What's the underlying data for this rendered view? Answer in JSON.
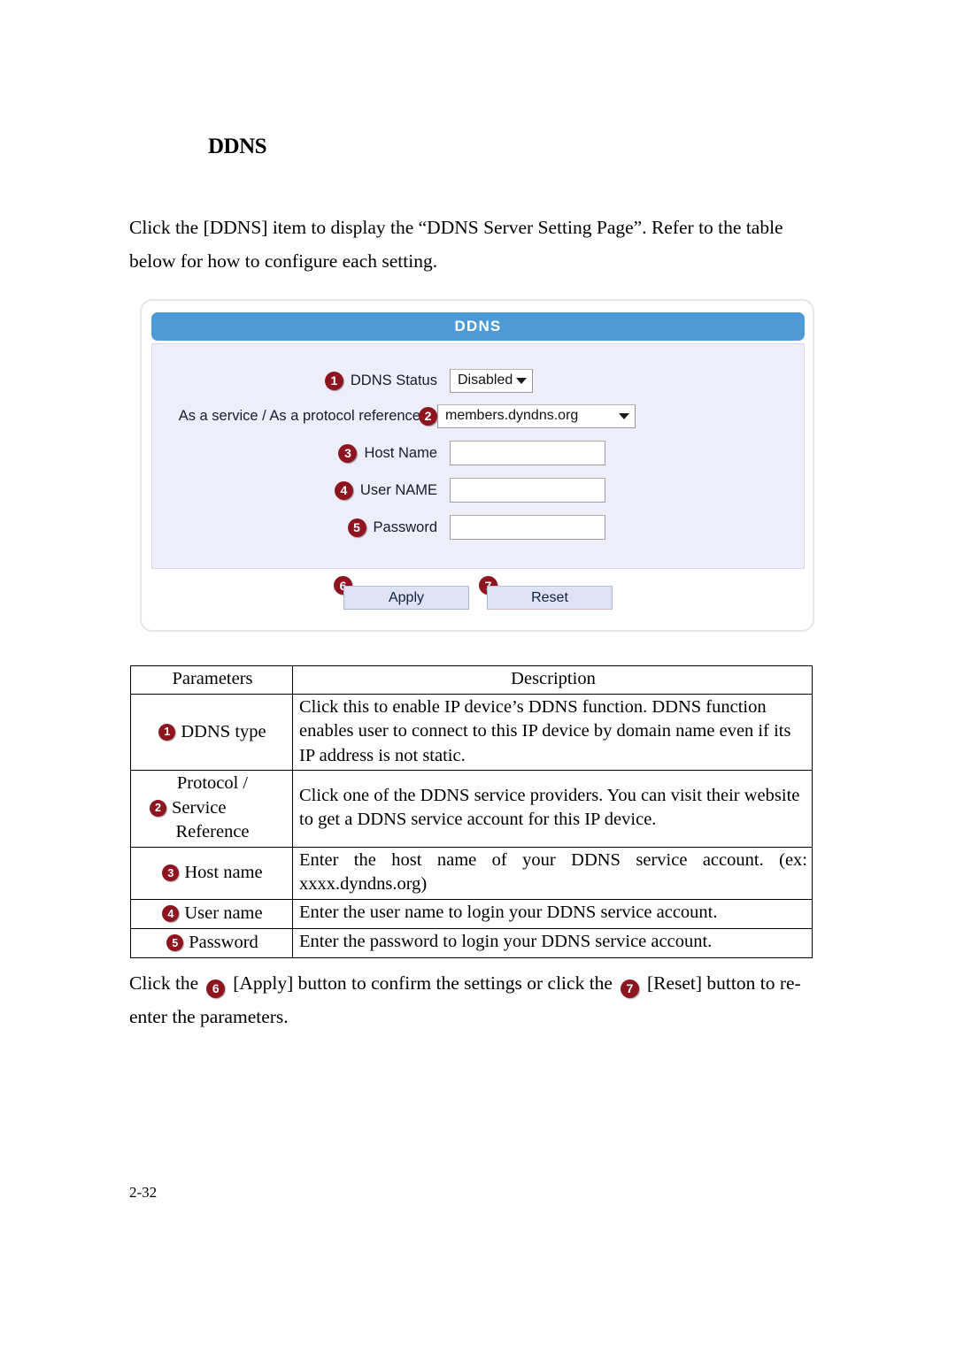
{
  "document": {
    "heading": "DDNS",
    "intro_paragraph": "Click the [DDNS] item to display the “DDNS Server Setting Page”. Refer to the table below for how to configure each setting.",
    "page_number": "2-32"
  },
  "ui_panel": {
    "title": "DDNS",
    "fields": [
      {
        "badge": "1",
        "label": "DDNS Status",
        "control": "select",
        "value": "Disabled"
      },
      {
        "badge": "2",
        "label": "As a service / As a protocol reference",
        "control": "select",
        "value": "members.dyndns.org"
      },
      {
        "badge": "3",
        "label": "Host Name",
        "control": "text",
        "value": ""
      },
      {
        "badge": "4",
        "label": "User NAME",
        "control": "text",
        "value": ""
      },
      {
        "badge": "5",
        "label": "Password",
        "control": "text",
        "value": ""
      }
    ],
    "buttons": [
      {
        "badge": "6",
        "label": "Apply"
      },
      {
        "badge": "7",
        "label": "Reset"
      }
    ]
  },
  "param_table": {
    "headers": {
      "parameters": "Parameters",
      "description": "Description"
    },
    "rows": [
      {
        "badge": "1",
        "parameter": "DDNS type",
        "description": "Click this to enable IP device’s DDNS function. DDNS function enables user to connect to this IP device by domain name even if its IP address is not static."
      },
      {
        "badge": "2",
        "parameter_line1": "Protocol /",
        "parameter_line2": "Service",
        "parameter_line3": "Reference",
        "description": "Click one of the DDNS service providers. You can visit their website to get a DDNS service account for this IP device."
      },
      {
        "badge": "3",
        "parameter": "Host name",
        "description": "Enter the host name of your DDNS service account. (ex: xxxx.dyndns.org)"
      },
      {
        "badge": "4",
        "parameter": "User name",
        "description": "Enter the user name to login your DDNS service account."
      },
      {
        "badge": "5",
        "parameter": "Password",
        "description": "Enter the password to login your DDNS service account."
      }
    ]
  },
  "closing": {
    "text_part1": "Click the",
    "badge_apply": "6",
    "text_part2": "[Apply] button to confirm the settings or click the",
    "badge_reset": "7",
    "text_part3": "[Reset] button to re-enter the parameters."
  },
  "colors": {
    "header_blue": "#4d9bd6",
    "panel_background": "#eeeefb",
    "badge_red": "#8e1420",
    "button_fill": "#dde3f5"
  }
}
